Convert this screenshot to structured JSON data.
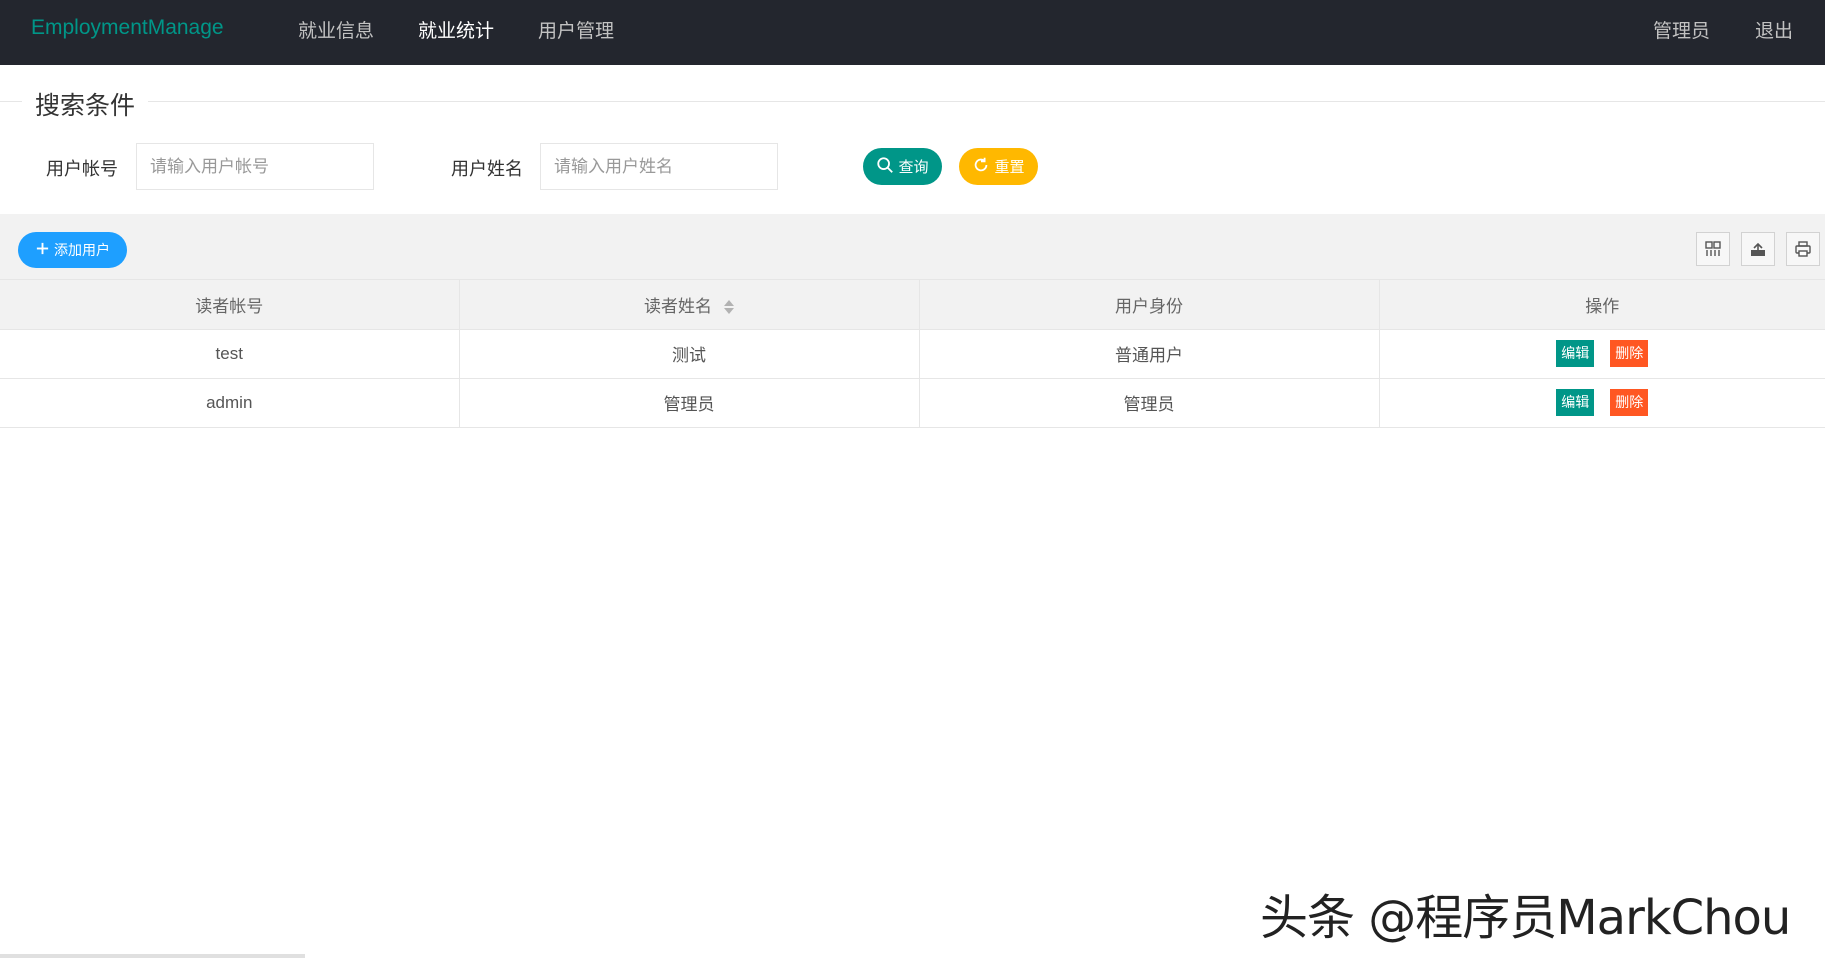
{
  "nav": {
    "logo": "EmploymentManage",
    "items": [
      "就业信息",
      "就业统计",
      "用户管理"
    ],
    "active_index": 1,
    "user": "管理员",
    "logout": "退出"
  },
  "search": {
    "legend": "搜索条件",
    "account_label": "用户帐号",
    "account_placeholder": "请输入用户帐号",
    "name_label": "用户姓名",
    "name_placeholder": "请输入用户姓名",
    "query_label": "查询",
    "reset_label": "重置"
  },
  "toolbar": {
    "add_label": "添加用户",
    "icons": [
      "columns-filter-icon",
      "export-icon",
      "print-icon"
    ]
  },
  "table": {
    "columns": [
      "读者帐号",
      "读者姓名",
      "用户身份",
      "操作"
    ],
    "sortable_column": 1,
    "edit_label": "编辑",
    "delete_label": "删除",
    "rows": [
      [
        "test",
        "测试",
        "普通用户"
      ],
      [
        "admin",
        "管理员",
        "管理员"
      ]
    ]
  },
  "watermark": "头条 @程序员MarkChou",
  "colors": {
    "nav_bg": "#23262e",
    "logo": "#009688",
    "query": "#009688",
    "reset": "#ffb800",
    "add": "#1e9fff",
    "delete": "#ff5722"
  }
}
